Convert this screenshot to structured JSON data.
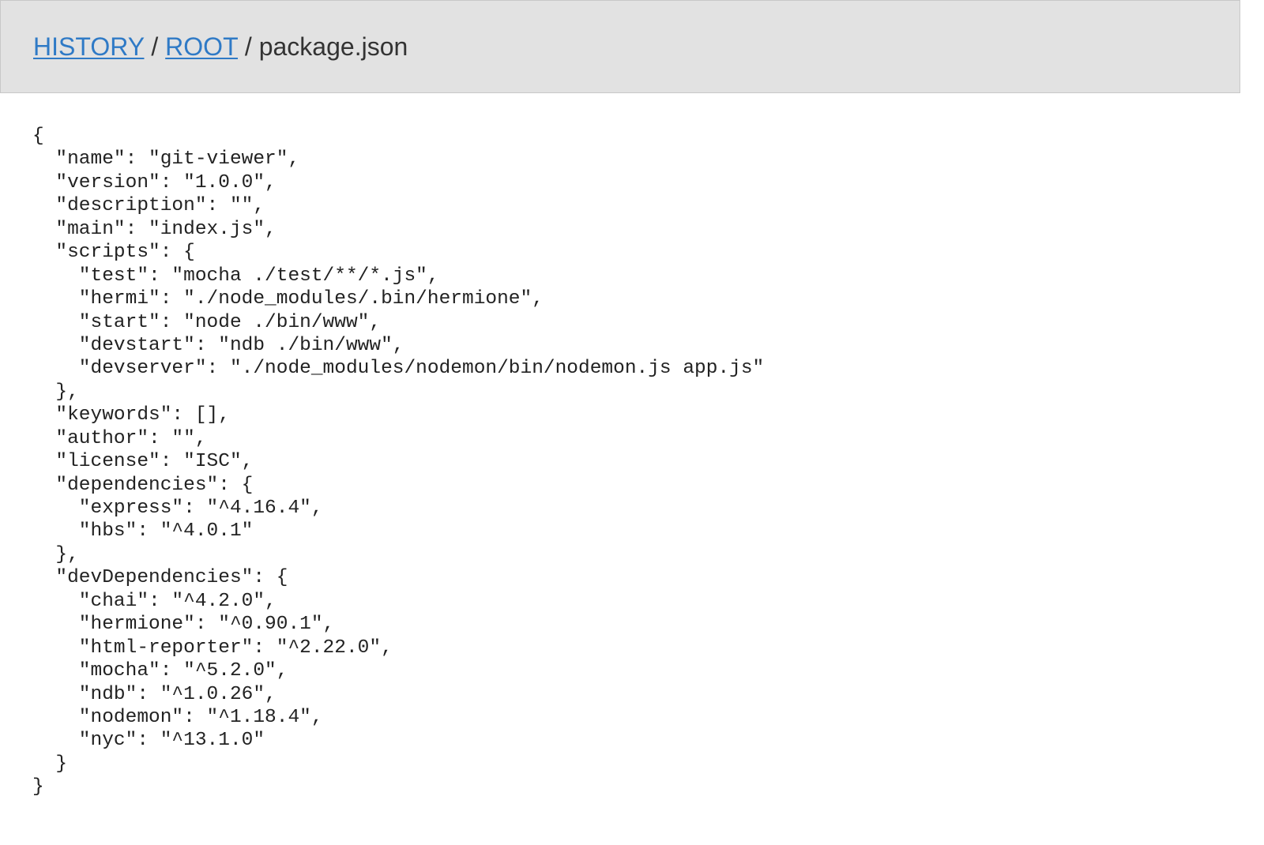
{
  "breadcrumb": {
    "history_label": "HISTORY",
    "root_label": "ROOT",
    "separator": "/",
    "current_file": "package.json"
  },
  "file_content": {
    "lines": [
      "{",
      "  \"name\": \"git-viewer\",",
      "  \"version\": \"1.0.0\",",
      "  \"description\": \"\",",
      "  \"main\": \"index.js\",",
      "  \"scripts\": {",
      "    \"test\": \"mocha ./test/**/*.js\",",
      "    \"hermi\": \"./node_modules/.bin/hermione\",",
      "    \"start\": \"node ./bin/www\",",
      "    \"devstart\": \"ndb ./bin/www\",",
      "    \"devserver\": \"./node_modules/nodemon/bin/nodemon.js app.js\"",
      "  },",
      "  \"keywords\": [],",
      "  \"author\": \"\",",
      "  \"license\": \"ISC\",",
      "  \"dependencies\": {",
      "    \"express\": \"^4.16.4\",",
      "    \"hbs\": \"^4.0.1\"",
      "  },",
      "  \"devDependencies\": {",
      "    \"chai\": \"^4.2.0\",",
      "    \"hermione\": \"^0.90.1\",",
      "    \"html-reporter\": \"^2.22.0\",",
      "    \"mocha\": \"^5.2.0\",",
      "    \"ndb\": \"^1.0.26\",",
      "    \"nodemon\": \"^1.18.4\",",
      "    \"nyc\": \"^13.1.0\"",
      "  }",
      "}"
    ]
  }
}
